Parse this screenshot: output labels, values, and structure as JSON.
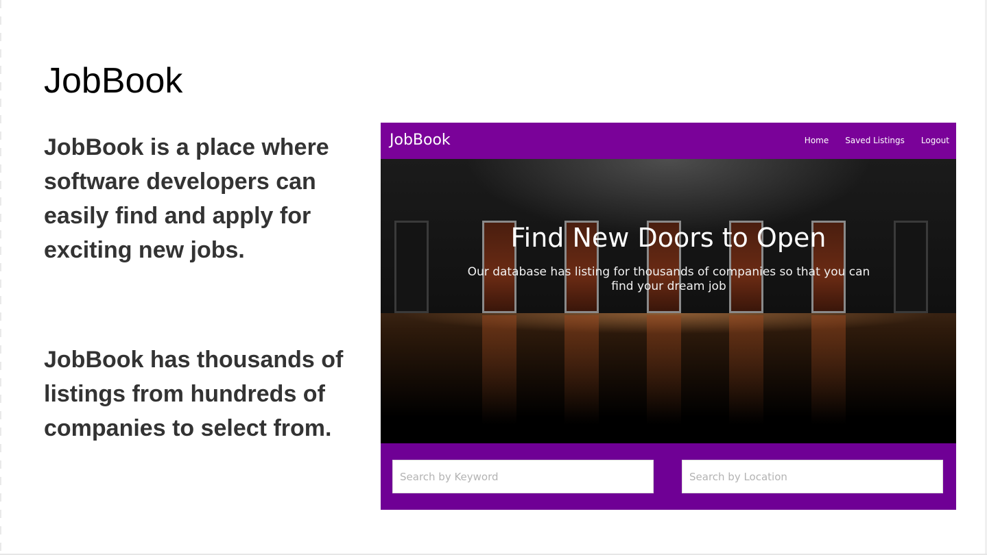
{
  "slide": {
    "title": "JobBook",
    "paragraphs": [
      "JobBook is a place where software developers can easily find and apply for exciting new jobs.",
      "JobBook has thousands of listings from hundreds of companies to select from."
    ]
  },
  "app": {
    "brand": "JobBook",
    "nav": [
      "Home",
      "Saved Listings",
      "Logout"
    ],
    "hero": {
      "title": "Find New Doors to Open",
      "subtitle": "Our database has listing for thousands of companies so that you can find your dream job"
    },
    "search": {
      "keyword_placeholder": "Search by Keyword",
      "location_placeholder": "Search by Location"
    },
    "colors": {
      "navbar": "#7a0299",
      "search_bar": "#6f0095"
    }
  }
}
